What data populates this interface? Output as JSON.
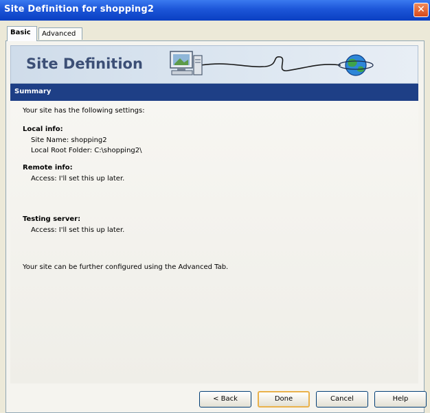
{
  "window": {
    "title": "Site Definition for shopping2",
    "close_glyph": "✕"
  },
  "tabs": [
    {
      "label": "Basic",
      "active": true
    },
    {
      "label": "Advanced",
      "active": false
    }
  ],
  "banner": {
    "title": "Site Definition"
  },
  "section": {
    "title": "Summary"
  },
  "summary": {
    "intro": "Your site has the following settings:",
    "local_header": "Local info:",
    "site_name": "Site Name: shopping2",
    "local_root": "Local Root Folder: C:\\shopping2\\",
    "remote_header": "Remote info:",
    "remote_access": "Access: I'll set this up later.",
    "testing_header": "Testing server:",
    "testing_access": "Access: I'll set this up later.",
    "footer_note": "Your site can be further configured using the Advanced Tab."
  },
  "buttons": {
    "back": "< Back",
    "done": "Done",
    "cancel": "Cancel",
    "help": "Help"
  },
  "colors": {
    "titlebar": "#0a3fc2",
    "section_bar": "#1e3f86",
    "banner_title": "#3c4f76"
  }
}
